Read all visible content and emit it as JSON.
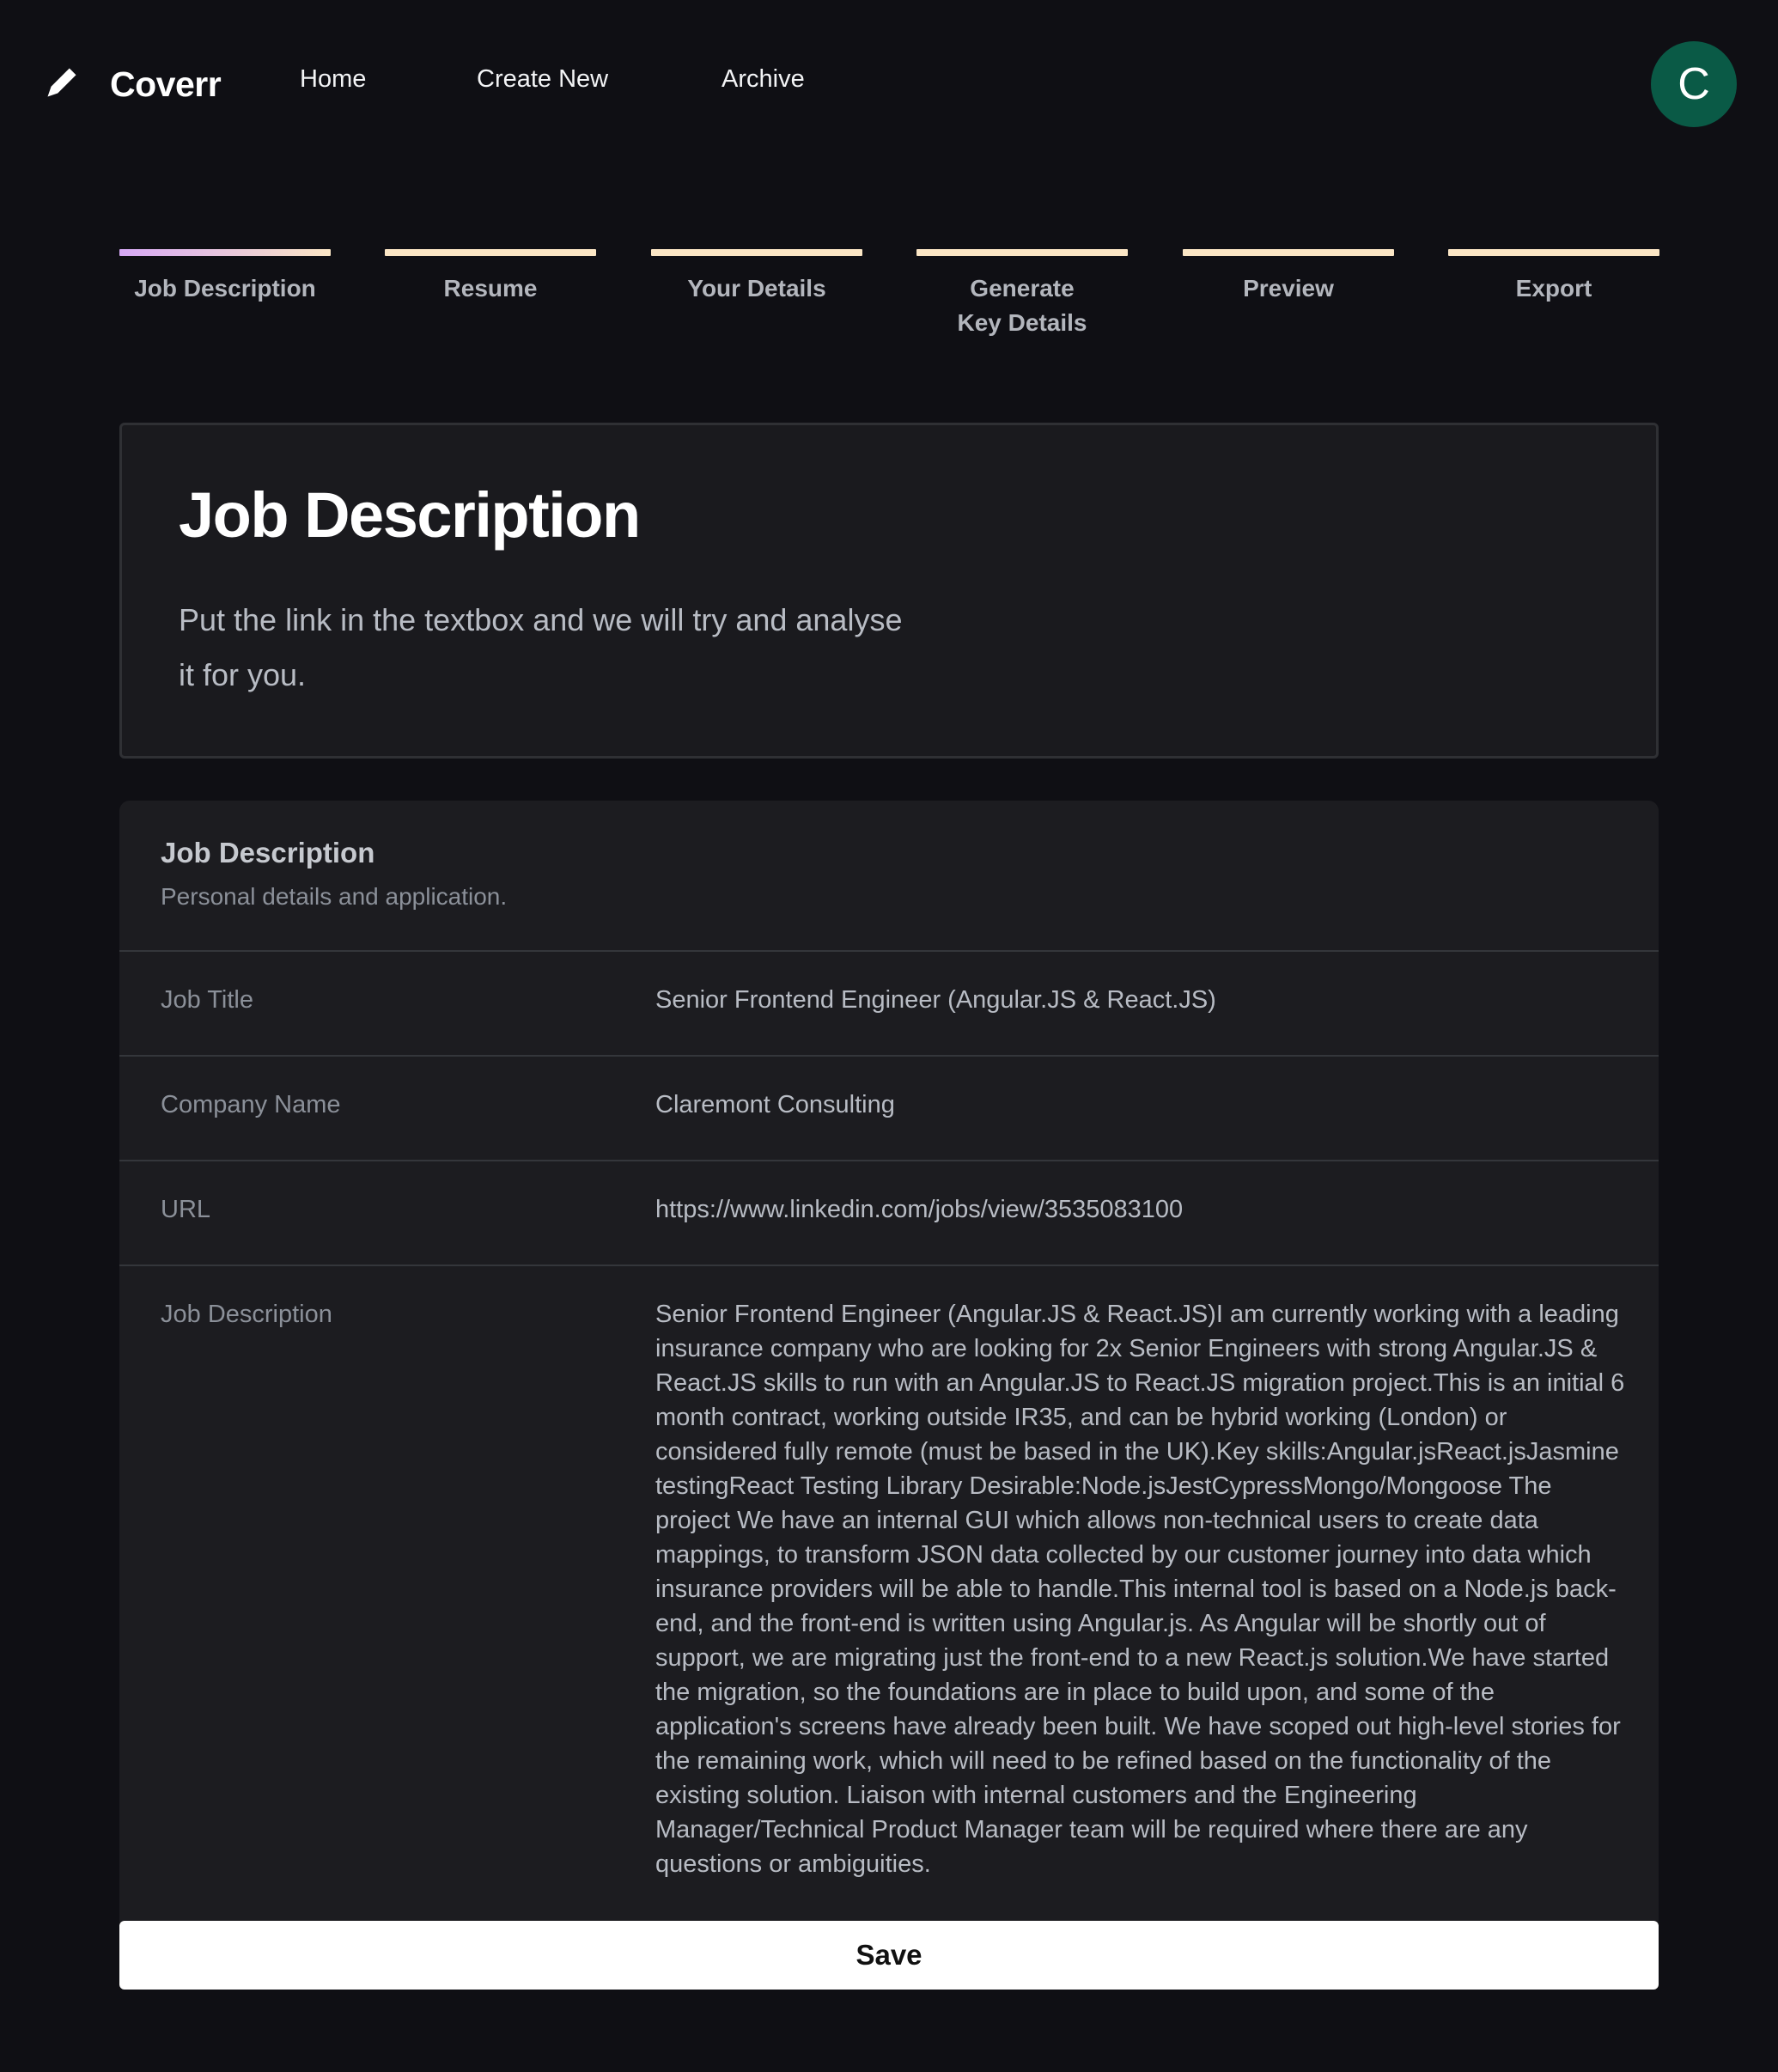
{
  "nav": {
    "brand": "Coverr",
    "links": [
      "Home",
      "Create New",
      "Archive"
    ],
    "avatar_initial": "C",
    "avatar_color": "#0a5a46"
  },
  "stepper": {
    "active_index": 0,
    "steps": [
      "Job Description",
      "Resume",
      "Your Details",
      "Generate Key Details",
      "Preview",
      "Export"
    ]
  },
  "intro": {
    "title": "Job Description",
    "text": "Put the link in the textbox and we will try and analyse it for you."
  },
  "details": {
    "title": "Job Description",
    "subtitle": "Personal details and application.",
    "rows": [
      {
        "label": "Job Title",
        "value": "Senior Frontend Engineer (Angular.JS & React.JS)"
      },
      {
        "label": "Company Name",
        "value": "Claremont Consulting"
      },
      {
        "label": "URL",
        "value": "https://www.linkedin.com/jobs/view/3535083100"
      },
      {
        "label": "Job Description",
        "value": "Senior Frontend Engineer (Angular.JS & React.JS)I am currently working with a leading insurance company who are looking for 2x Senior Engineers with strong Angular.JS & React.JS skills to run with an Angular.JS to React.JS migration project.This is an initial 6 month contract, working outside IR35, and can be hybrid working (London) or considered fully remote (must be based in the UK).Key skills:Angular.jsReact.jsJasmine testingReact Testing Library Desirable:Node.jsJestCypressMongo/Mongoose The project We have an internal GUI which allows non-technical users to create data mappings, to transform JSON data collected by our customer journey into data which insurance providers will be able to handle.This internal tool is based on a Node.js back-end, and the front-end is written using Angular.js. As Angular will be shortly out of support, we are migrating just the front-end to a new React.js solution.We have started the migration, so the foundations are in place to build upon, and some of the application's screens have already been built. We have scoped out high-level stories for the remaining work, which will need to be refined based on the functionality of the existing solution. Liaison with internal customers and the Engineering Manager/Technical Product Manager team will be required where there are any questions or ambiguities."
      }
    ]
  },
  "save_label": "Save"
}
